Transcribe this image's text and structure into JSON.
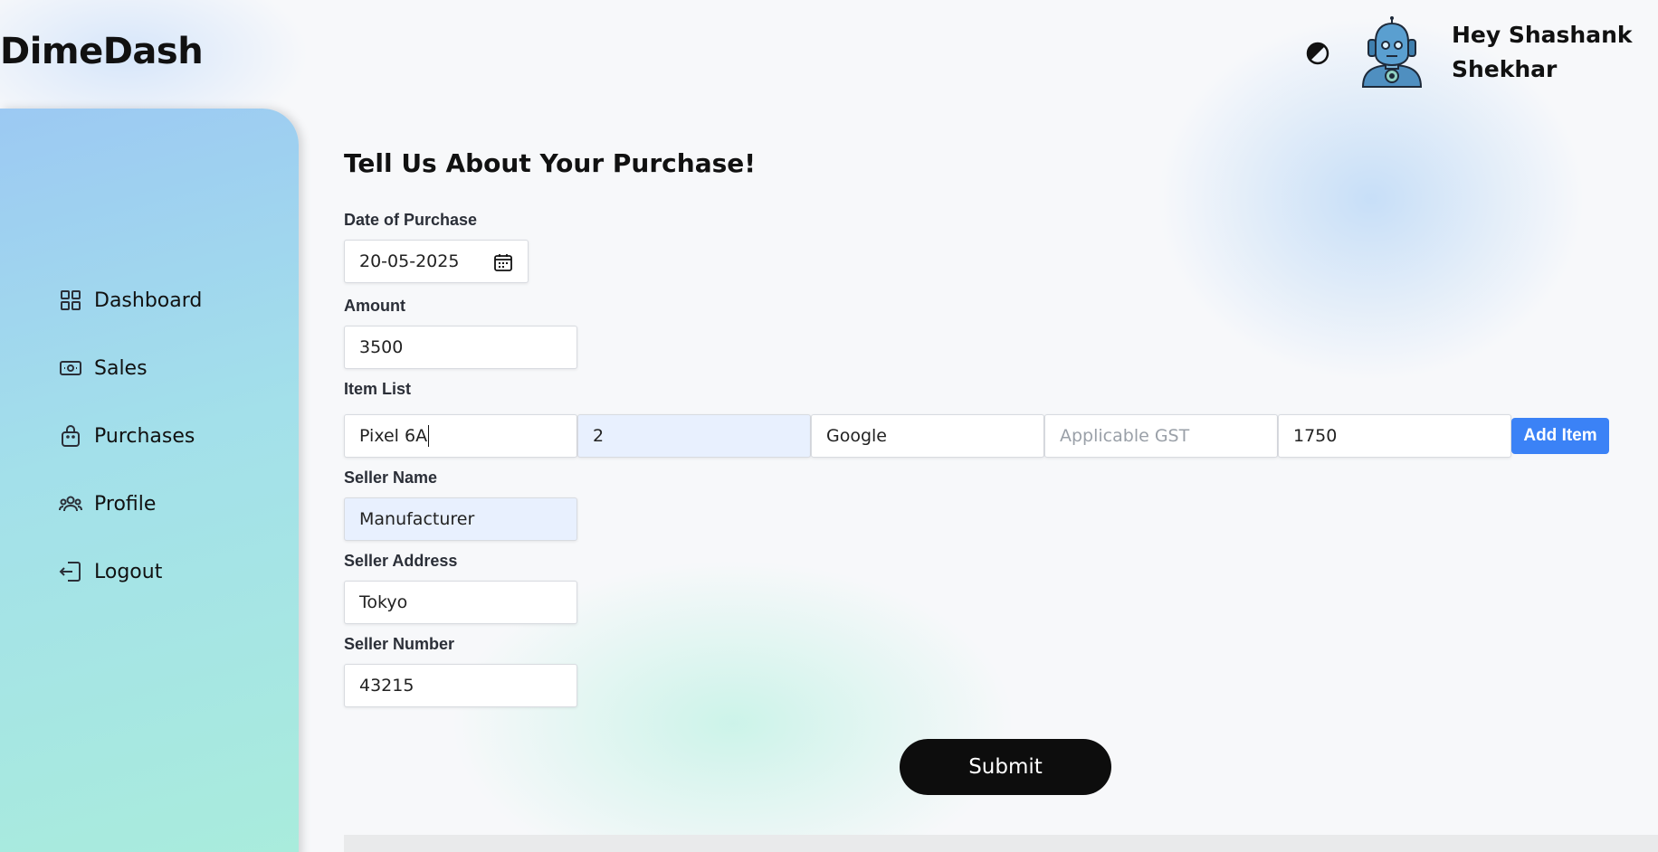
{
  "app": {
    "name": "DimeDash"
  },
  "header": {
    "greeting": "Hey Shashank Shekhar",
    "theme_icon": "contrast-icon",
    "avatar_icon": "robot-avatar"
  },
  "sidebar": {
    "items": [
      {
        "label": "Dashboard",
        "icon": "grid-icon"
      },
      {
        "label": "Sales",
        "icon": "cash-icon"
      },
      {
        "label": "Purchases",
        "icon": "bag-icon"
      },
      {
        "label": "Profile",
        "icon": "users-icon"
      },
      {
        "label": "Logout",
        "icon": "logout-icon"
      }
    ]
  },
  "form": {
    "title": "Tell Us About Your Purchase!",
    "date_label": "Date of Purchase",
    "date_value": "20-05-2025",
    "amount_label": "Amount",
    "amount_value": "3500",
    "item_list_label": "Item List",
    "item": {
      "name": "Pixel 6A",
      "quantity": "2",
      "brand": "Google",
      "gst_placeholder": "Applicable GST",
      "price": "1750"
    },
    "add_item_label": "Add Item",
    "seller_name_label": "Seller Name",
    "seller_name_value": "Manufacturer",
    "seller_address_label": "Seller Address",
    "seller_address_value": "Tokyo",
    "seller_number_label": "Seller Number",
    "seller_number_value": "43215",
    "submit_label": "Submit"
  },
  "colors": {
    "accent": "#3b82f6",
    "sidebar_top": "#9cc9f3",
    "sidebar_bottom": "#a9ecdc"
  }
}
